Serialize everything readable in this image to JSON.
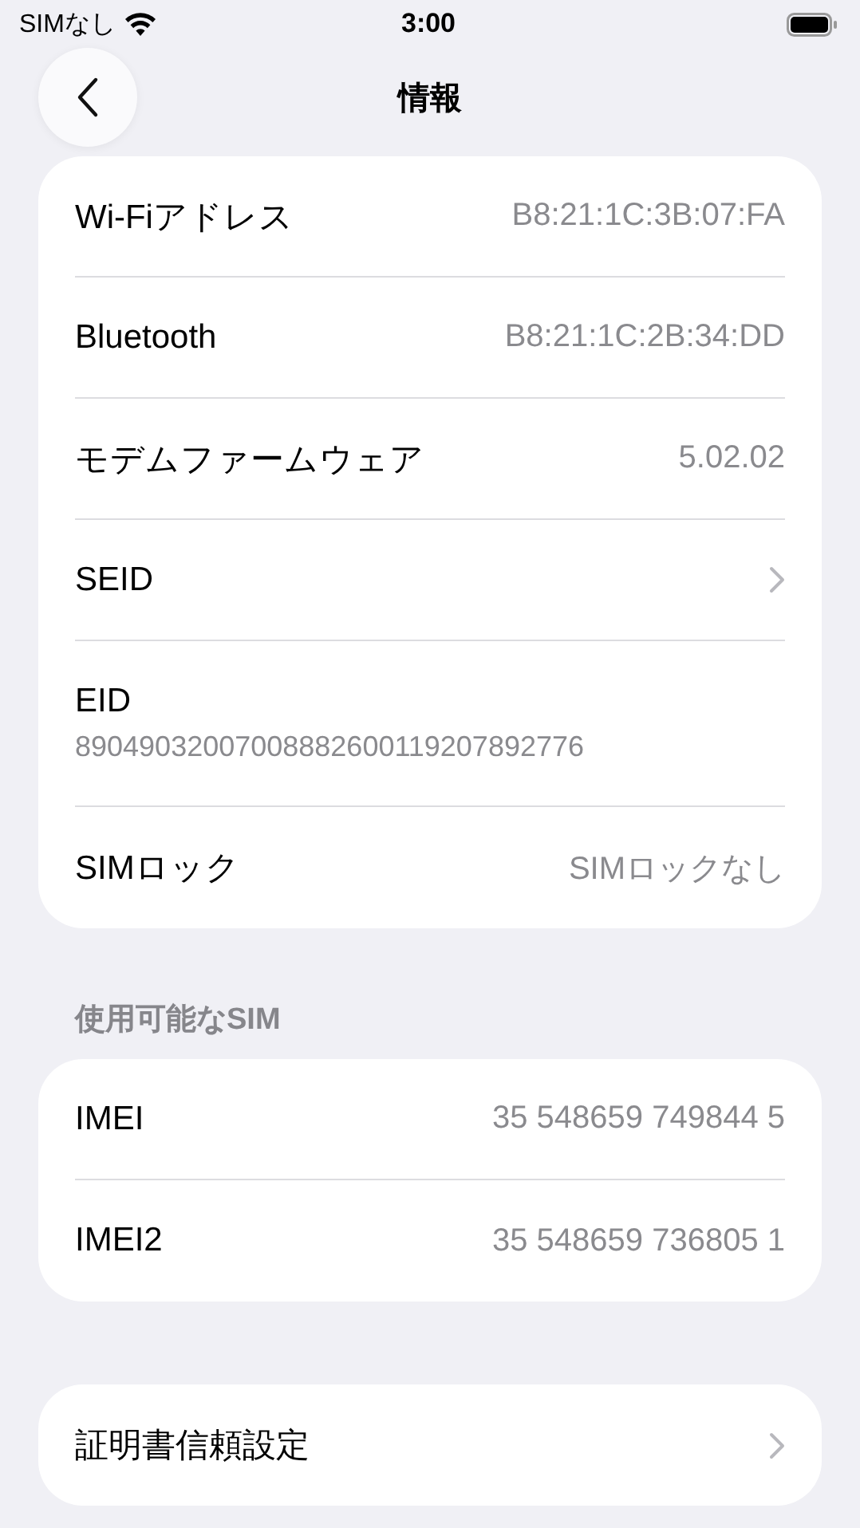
{
  "status_bar": {
    "carrier": "SIMなし",
    "time": "3:00"
  },
  "nav": {
    "title": "情報"
  },
  "sections": [
    {
      "rows": [
        {
          "kind": "value",
          "label": "Wi-Fiアドレス",
          "value": "B8:21:1C:3B:07:FA"
        },
        {
          "kind": "value",
          "label": "Bluetooth",
          "value": "B8:21:1C:2B:34:DD"
        },
        {
          "kind": "value",
          "label": "モデムファームウェア",
          "value": "5.02.02"
        },
        {
          "kind": "chevron",
          "label": "SEID"
        },
        {
          "kind": "stacked",
          "label": "EID",
          "value": "89049032007008882600119207892776"
        },
        {
          "kind": "value",
          "label": "SIMロック",
          "value": "SIMロックなし"
        }
      ]
    },
    {
      "header": "使用可能なSIM",
      "rows": [
        {
          "kind": "value",
          "label": "IMEI",
          "value": "35 548659 749844 5"
        },
        {
          "kind": "value",
          "label": "IMEI2",
          "value": "35 548659 736805 1"
        }
      ]
    },
    {
      "rows": [
        {
          "kind": "chevron",
          "label": "証明書信頼設定"
        }
      ]
    }
  ]
}
